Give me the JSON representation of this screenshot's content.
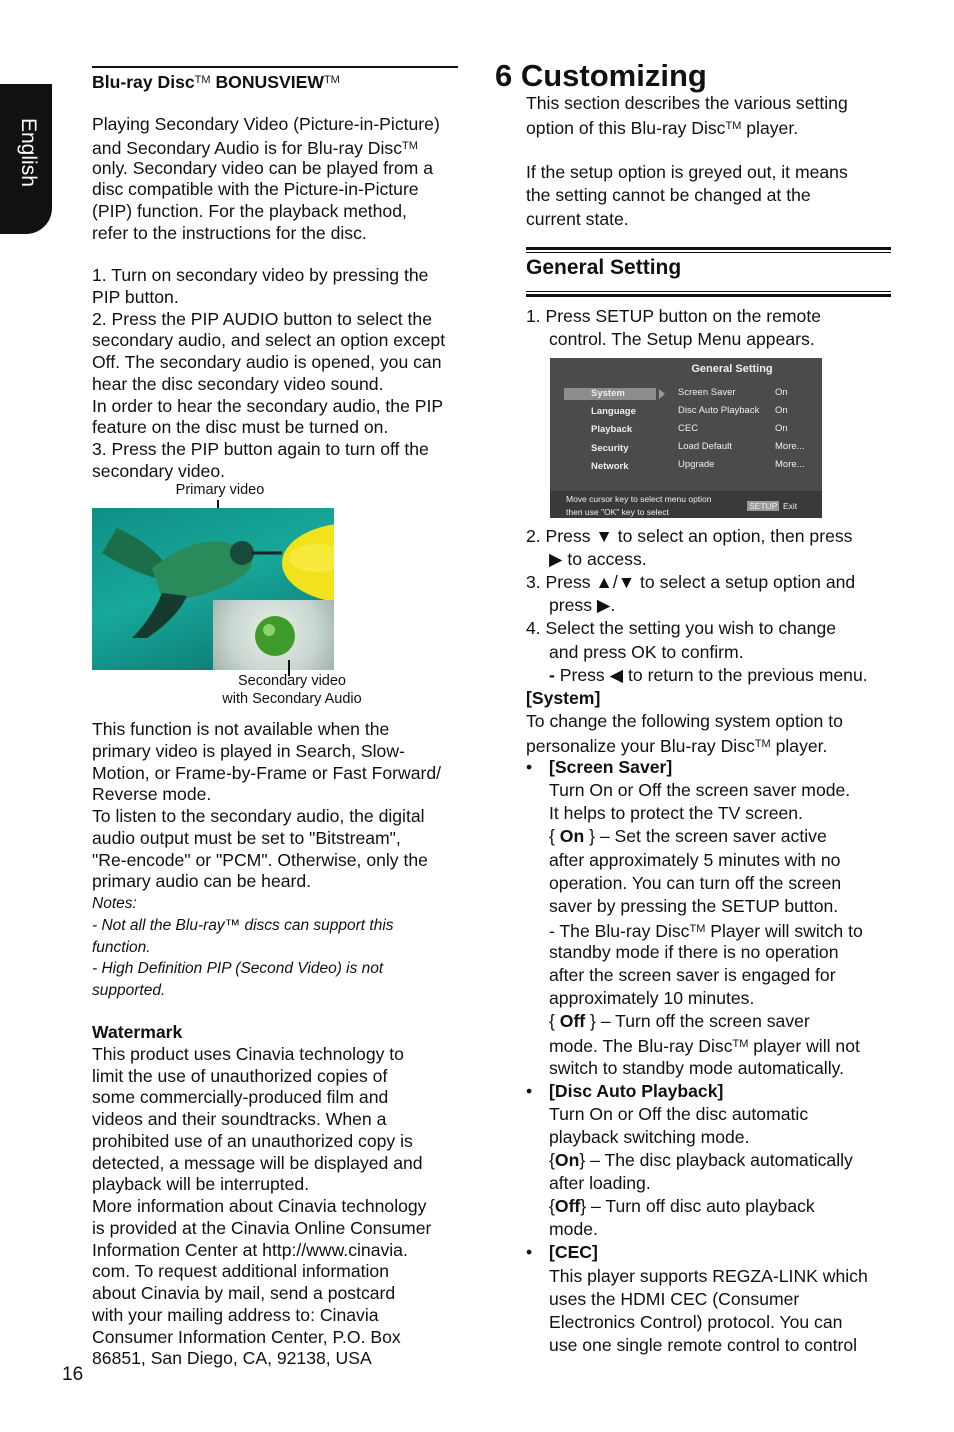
{
  "side_tab": "English",
  "page_number": "16",
  "left": {
    "heading": [
      {
        "t": "Blu-ray Disc",
        "s": "b"
      },
      {
        "t": "TM",
        "s": "sup"
      },
      {
        "t": " BONUSVIEW",
        "s": "b"
      },
      {
        "t": "TM",
        "s": "sup"
      }
    ],
    "intro": [
      "Playing Secondary Video (Picture-in-Picture)",
      [
        {
          "t": "and Secondary Audio is for Blu-ray Disc"
        },
        {
          "t": "TM",
          "s": "sup"
        }
      ],
      "only. Secondary video can be played from a",
      "disc compatible with the Picture-in-Picture",
      "(PIP) function. For the playback method,",
      "refer to the instructions for the disc."
    ],
    "steps": [
      "1. Turn on secondary video by pressing the",
      "PIP button.",
      "2. Press the PIP AUDIO button to select the",
      "secondary audio, and select an option except",
      "Off. The secondary audio is opened, you can",
      "hear the disc secondary video sound.",
      "In order to hear the secondary audio, the PIP",
      "feature on the disc must be turned on.",
      "3. Press the PIP button again to turn off the",
      "secondary video."
    ],
    "figure": {
      "primary_label": "Primary video",
      "secondary_label_1": "Secondary video",
      "secondary_label_2": "with Secondary Audio"
    },
    "availability": [
      "This function is not available when the",
      "primary video is played in Search, Slow-",
      "Motion, or Frame-by-Frame or Fast Forward/",
      "Reverse mode.",
      "To listen to the secondary audio, the digital",
      "audio output must be set to \"Bitstream\",",
      "\"Re-encode\" or \"PCM\". Otherwise, only the",
      "primary audio can be heard."
    ],
    "notes": [
      "Notes:",
      "- Not all the Blu-ray™ discs can support this",
      "function.",
      "- High Definition PIP (Second Video) is not",
      "supported."
    ],
    "watermark": [
      [
        {
          "t": "Watermark",
          "s": "b"
        }
      ],
      "This product uses Cinavia technology to",
      "limit the use of unauthorized copies of",
      "some commercially-produced film and",
      "videos and their soundtracks. When a",
      "prohibited use of an unauthorized copy is",
      "detected, a message will be displayed and",
      "playback will be interrupted.",
      "More information about Cinavia technology",
      "is provided at the Cinavia Online Consumer",
      "Information Center at http://www.cinavia.",
      "com. To request additional information",
      "about Cinavia by mail, send a postcard",
      "with your mailing address to: Cinavia",
      "Consumer Information Center, P.O. Box",
      "86851, San Diego, CA, 92138, USA"
    ]
  },
  "right": {
    "chapter_title": "6  Customizing",
    "intro": [
      "This  section  describes  the  various  setting",
      [
        {
          "t": "option of this Blu-ray Disc"
        },
        {
          "t": "TM",
          "s": "sup"
        },
        {
          "t": " player."
        }
      ],
      "",
      "If the setup option is greyed out, it means",
      "the setting cannot be changed at the",
      "current state."
    ],
    "section_heading": "General Setting",
    "step1": [
      "1. Press SETUP button on the remote",
      "control. The Setup Menu appears."
    ],
    "menu": {
      "title": "General Setting",
      "categories": [
        "System",
        "Language",
        "Playback",
        "Security",
        "Network"
      ],
      "selected_category": "System",
      "options": [
        {
          "label": "Screen Saver",
          "value": "On"
        },
        {
          "label": "Disc Auto Playback",
          "value": "On"
        },
        {
          "label": "CEC",
          "value": "On"
        },
        {
          "label": "Load Default",
          "value": "More..."
        },
        {
          "label": "Upgrade",
          "value": "More..."
        }
      ],
      "footer_line1": "Move cursor key to select menu option",
      "footer_line2": "then use \"OK\" key to select",
      "setup_key": "SETUP",
      "exit_label": "Exit"
    },
    "body": [
      "2. Press ▼ to select an option, then press",
      "▶ to access.",
      "3. Press ▲/▼ to select a setup option and",
      "press ▶.",
      "4. Select the setting you wish to change",
      "and press OK to confirm.",
      [
        {
          "t": "-",
          "s": "b"
        },
        {
          "t": " Press ◀ to return to the previous menu."
        }
      ],
      [
        {
          "t": "[System]",
          "s": "b"
        }
      ],
      "To change the following system option to",
      [
        {
          "t": "personalize your Blu-ray Disc"
        },
        {
          "t": "TM",
          "s": "sup"
        },
        {
          "t": " player."
        }
      ],
      [
        {
          "t": "•",
          "s": "bullet"
        },
        {
          "t": "[Screen Saver]",
          "s": "b"
        }
      ],
      "Turn On or Off the screen saver mode.",
      "It helps to protect the TV screen.",
      [
        {
          "t": "{ "
        },
        {
          "t": "On",
          "s": "b"
        },
        {
          "t": " } – Set the screen saver active"
        }
      ],
      "after approximately 5 minutes with no",
      "operation. You can turn off the screen",
      "saver by pressing the SETUP button.",
      [
        {
          "t": "- The Blu-ray Disc"
        },
        {
          "t": "TM",
          "s": "sup"
        },
        {
          "t": " Player will switch to"
        }
      ],
      "standby mode if there is no operation",
      "after the screen saver is engaged for",
      "approximately 10 minutes.",
      [
        {
          "t": "{ "
        },
        {
          "t": "Off",
          "s": "b"
        },
        {
          "t": " } – Turn off the screen saver"
        }
      ],
      [
        {
          "t": "mode. The Blu-ray Disc"
        },
        {
          "t": "TM",
          "s": "sup"
        },
        {
          "t": " player will not"
        }
      ],
      "switch to standby mode automatically.",
      [
        {
          "t": "•",
          "s": "bullet"
        },
        {
          "t": "[Disc Auto Playback]",
          "s": "b"
        }
      ],
      "Turn On or Off the disc automatic",
      "playback switching mode.",
      [
        {
          "t": "{"
        },
        {
          "t": "On",
          "s": "b"
        },
        {
          "t": "} – The disc playback automatically"
        }
      ],
      "after loading.",
      [
        {
          "t": "{"
        },
        {
          "t": "Off",
          "s": "b"
        },
        {
          "t": "} – Turn off disc auto playback"
        }
      ],
      "mode.",
      [
        {
          "t": "•",
          "s": "bullet"
        },
        {
          "t": "[CEC]",
          "s": "b"
        }
      ],
      "This player supports REGZA-LINK which",
      "uses the HDMI CEC (Consumer",
      "Electronics Control) protocol. You can",
      "use one single remote control to control"
    ]
  }
}
